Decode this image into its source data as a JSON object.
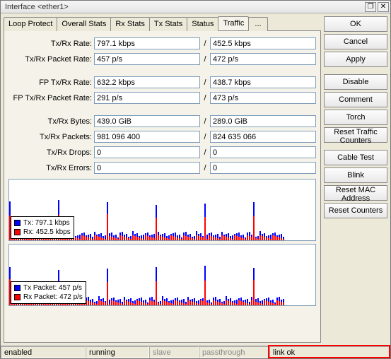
{
  "title": "Interface <ether1>",
  "tabs": {
    "items": [
      "Loop Protect",
      "Overall Stats",
      "Rx Stats",
      "Tx Stats",
      "Status",
      "Traffic",
      "..."
    ],
    "active": 5
  },
  "fields": {
    "txrx_rate": {
      "label": "Tx/Rx Rate:",
      "tx": "797.1 kbps",
      "rx": "452.5 kbps"
    },
    "txrx_packet_rate": {
      "label": "Tx/Rx Packet Rate:",
      "tx": "457 p/s",
      "rx": "472 p/s"
    },
    "fp_txrx_rate": {
      "label": "FP Tx/Rx Rate:",
      "tx": "632.2 kbps",
      "rx": "438.7 kbps"
    },
    "fp_txrx_packet_rate": {
      "label": "FP Tx/Rx Packet Rate:",
      "tx": "291 p/s",
      "rx": "473 p/s"
    },
    "txrx_bytes": {
      "label": "Tx/Rx Bytes:",
      "tx": "439.0 GiB",
      "rx": "289.0 GiB"
    },
    "txrx_packets": {
      "label": "Tx/Rx Packets:",
      "tx": "981 096 400",
      "rx": "824 635 066"
    },
    "txrx_drops": {
      "label": "Tx/Rx Drops:",
      "tx": "0",
      "rx": "0"
    },
    "txrx_errors": {
      "label": "Tx/Rx Errors:",
      "tx": "0",
      "rx": "0"
    }
  },
  "buttons": {
    "ok": "OK",
    "cancel": "Cancel",
    "apply": "Apply",
    "disable": "Disable",
    "comment": "Comment",
    "torch": "Torch",
    "reset_traffic": "Reset Traffic Counters",
    "cable_test": "Cable Test",
    "blink": "Blink",
    "reset_mac": "Reset MAC Address",
    "reset_counters": "Reset Counters"
  },
  "legend1": {
    "tx": "Tx: 797.1 kbps",
    "rx": "Rx: 452.5 kbps"
  },
  "legend2": {
    "tx": "Tx Packet: 457 p/s",
    "rx": "Rx Packet: 472 p/s"
  },
  "status": {
    "enabled": "enabled",
    "running": "running",
    "slave": "slave",
    "passthrough": "passthrough",
    "link": "link ok"
  },
  "chart_data": [
    {
      "type": "bar",
      "title": "Tx/Rx Rate",
      "series": [
        {
          "name": "Tx",
          "color": "#0000ff",
          "unit": "kbps"
        },
        {
          "name": "Rx",
          "color": "#ff0000",
          "unit": "kbps"
        }
      ],
      "note": "realtime traffic sparkline; current Tx 797.1 kbps, Rx 452.5 kbps"
    },
    {
      "type": "bar",
      "title": "Tx/Rx Packet Rate",
      "series": [
        {
          "name": "Tx Packet",
          "color": "#0000ff",
          "unit": "p/s"
        },
        {
          "name": "Rx Packet",
          "color": "#ff0000",
          "unit": "p/s"
        }
      ],
      "note": "realtime packet-rate sparkline; current Tx 457 p/s, Rx 472 p/s"
    }
  ]
}
